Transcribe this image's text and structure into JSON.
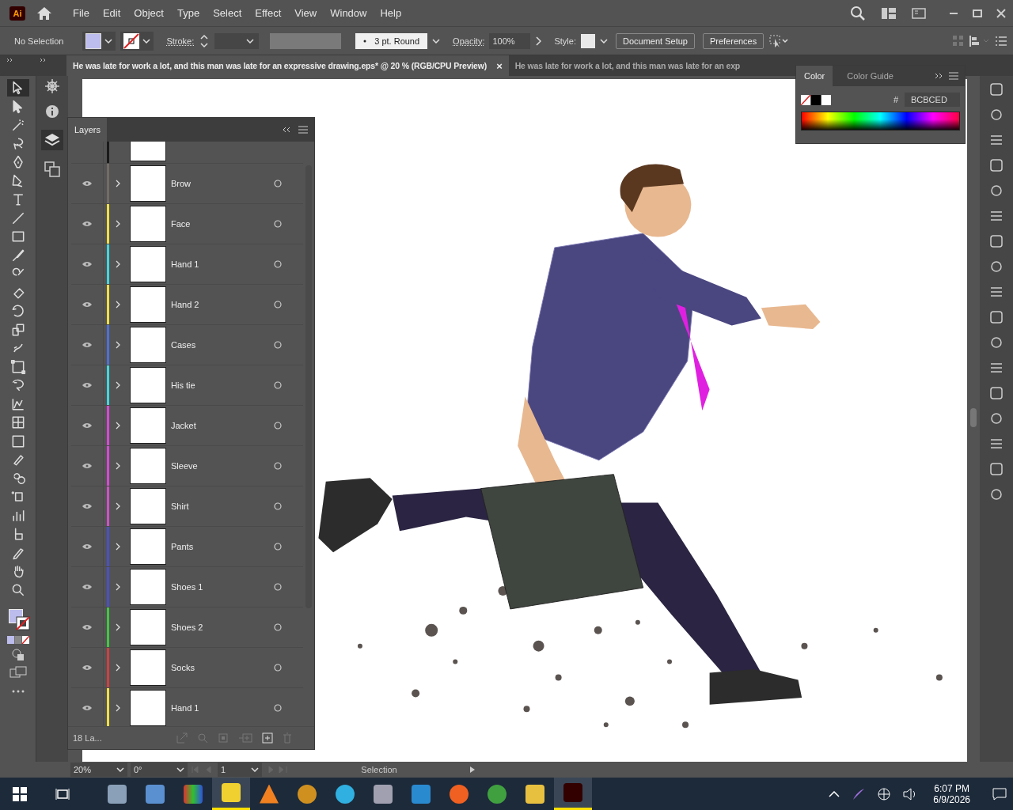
{
  "menu": [
    "File",
    "Edit",
    "Object",
    "Type",
    "Select",
    "Effect",
    "View",
    "Window",
    "Help"
  ],
  "app_logo": "Ai",
  "control_bar": {
    "selection": "No Selection",
    "stroke_label": "Stroke:",
    "brush": "3 pt. Round",
    "opacity_label": "Opacity:",
    "opacity": "100%",
    "style_label": "Style:",
    "buttons": [
      "Document Setup",
      "Preferences"
    ]
  },
  "tabs": [
    {
      "title": "He was late for work a lot, and this man was late for an expressive drawing.eps* @ 20 % (RGB/CPU Preview)",
      "selected": true,
      "close": "×"
    },
    {
      "title": "He was late for work a lot, and this man was late for an exp",
      "selected": false
    }
  ],
  "tools": [
    {
      "selected": true
    },
    {
      "selected": false
    },
    {
      "selected": false
    },
    {
      "selected": false
    },
    {
      "selected": false
    },
    {
      "selected": false
    },
    {
      "selected": false
    },
    {
      "selected": false
    },
    {
      "selected": false
    },
    {
      "selected": false
    },
    {
      "selected": false
    },
    {
      "selected": false
    },
    {
      "selected": false
    },
    {
      "selected": false
    },
    {
      "selected": false
    },
    {
      "selected": false
    },
    {
      "selected": false
    },
    {
      "selected": false
    },
    {
      "selected": false
    },
    {
      "selected": false
    },
    {
      "selected": false
    },
    {
      "selected": false
    },
    {
      "selected": false
    },
    {
      "selected": false
    },
    {
      "selected": false
    },
    {
      "selected": false
    },
    {
      "selected": false
    },
    {
      "selected": false
    }
  ],
  "layers_panel": {
    "title": "Layers",
    "footer": "18 La...",
    "layers": [
      {
        "color": "#1a1a1a"
      },
      {
        "name": "Brow",
        "color": "#736c66",
        "visible": true
      },
      {
        "name": "Face",
        "color": "#f0e040",
        "visible": true
      },
      {
        "name": "Hand 1",
        "color": "#40d8e0",
        "visible": true
      },
      {
        "name": "Hand 2",
        "color": "#f0e040",
        "visible": true
      },
      {
        "name": "Cases",
        "color": "#4f70d8",
        "visible": true
      },
      {
        "name": "His tie",
        "color": "#40d8e0",
        "visible": true
      },
      {
        "name": "Jacket",
        "color": "#d848d8",
        "visible": true
      },
      {
        "name": "Sleeve",
        "color": "#d848d8",
        "visible": true
      },
      {
        "name": "Shirt",
        "color": "#d050c8",
        "visible": true
      },
      {
        "name": "Pants",
        "color": "#4a50c8",
        "visible": true
      },
      {
        "name": "Shoes 1",
        "color": "#4a50c8",
        "visible": true
      },
      {
        "name": "Shoes 2",
        "color": "#40c840",
        "visible": true
      },
      {
        "name": "Socks",
        "color": "#d04040",
        "visible": true
      },
      {
        "name": "Hand 1",
        "color": "#f0e040",
        "visible": true
      }
    ]
  },
  "color_panel": {
    "tabs": [
      {
        "label": "Color",
        "selected": true
      },
      {
        "label": "Color Guide",
        "selected": false
      }
    ],
    "hash": "#",
    "hex": "BCBCED"
  },
  "status_bar": {
    "zoom": "20%",
    "rotation": "0°",
    "artboard": "1",
    "tool": "Selection"
  },
  "taskbar": {
    "apps": [
      {
        "selected": false
      },
      {
        "selected": false
      },
      {
        "selected": false
      },
      {
        "selected": true
      },
      {
        "selected": false
      },
      {
        "selected": false
      },
      {
        "selected": false
      },
      {
        "selected": false
      },
      {
        "selected": false
      },
      {
        "selected": false
      },
      {
        "selected": false
      },
      {
        "selected": false
      },
      {
        "selected": true
      }
    ],
    "time": "6:07 PM",
    "date": "6/9/2026"
  }
}
